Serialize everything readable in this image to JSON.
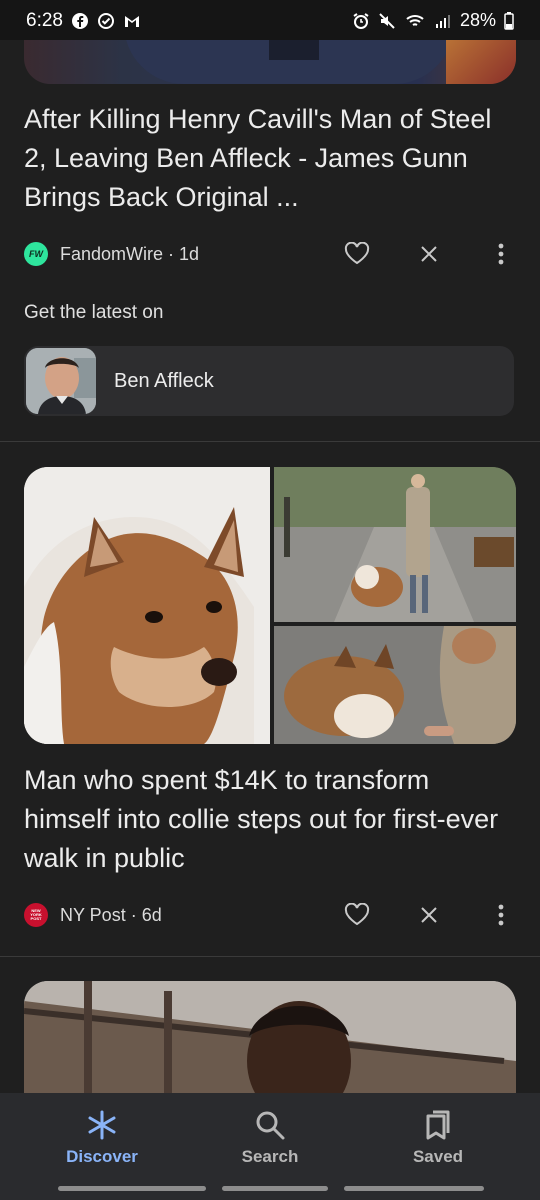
{
  "status_bar": {
    "time": "6:28",
    "battery": "28%"
  },
  "feed": {
    "card1": {
      "headline": "After Killing Henry Cavill's Man of Steel 2, Leaving Ben Affleck - James Gunn Brings Back Original ...",
      "source": "FandomWire · 1d",
      "source_logo_text": "FW"
    },
    "get_latest": {
      "label": "Get the latest on",
      "topic": "Ben Affleck"
    },
    "card2": {
      "headline": "Man who spent $14K to transform himself into collie steps out for first-ever walk in public",
      "source": "NY Post · 6d",
      "source_logo_text": "NEW YORK POST"
    }
  },
  "bottom_nav": {
    "items": [
      {
        "label": "Discover",
        "icon": "asterisk-icon",
        "active": true
      },
      {
        "label": "Search",
        "icon": "search-icon",
        "active": false
      },
      {
        "label": "Saved",
        "icon": "bookmarks-icon",
        "active": false
      }
    ]
  },
  "colors": {
    "background": "#1f1f1f",
    "nav_background": "#2a2b2e",
    "accent": "#8ab4f8",
    "fandomwire_logo": "#2ee59d",
    "nypost_logo": "#c8102e"
  }
}
